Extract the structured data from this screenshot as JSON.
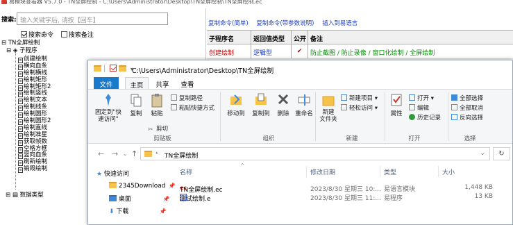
{
  "background_app": {
    "title": "易模块查看器 V5.7.0 - TN全屏绘制 - C:\\Users\\Administrator\\Desktop\\TN全屏绘制\\TN全屏绘制.ec",
    "search": {
      "label": "搜索:",
      "placeholder": "输入关键字后, 请按【回车】"
    },
    "filters": [
      {
        "label": "搜索命令",
        "checked": true
      },
      {
        "label": "搜索备注",
        "checked": false
      }
    ],
    "tree": {
      "root": "TN全屏绘制",
      "subprogram": "子程序",
      "items": [
        "创建绘制",
        "横向血条",
        "绘制横线",
        "绘制矩形",
        "绘制矩形2",
        "绘制竖线",
        "绘制文本",
        "绘制线条",
        "绘制圆形",
        "绘制圆形2",
        "绘制直线",
        "绘制准星",
        "获取帧数",
        "空格方框",
        "竖向血条",
        "刷新绘制",
        "销毁绘制"
      ],
      "datatype": "数据类型"
    },
    "links": [
      "复制命令(简单)",
      "复制命令(带参数说明)",
      "插入到易语言"
    ],
    "table": {
      "headers": [
        "子程序名",
        "返回值类型",
        "公开",
        "备注"
      ],
      "rows": [
        {
          "name": "创建绘制",
          "return_type": "逻辑型",
          "public": "✔",
          "note": "防止截图 / 防止录像 / 窗口化绘制 / 全屏绘制"
        }
      ]
    }
  },
  "explorer": {
    "title_path": "C:\\Users\\Administrator\\Desktop\\TN全屏绘制",
    "tabs": [
      "文件",
      "主页",
      "共享",
      "查看"
    ],
    "ribbon": {
      "pin_quick_access": "固定到\"快\n速访问\"",
      "copy": "复制",
      "paste": "粘贴",
      "copy_path": "复制路径",
      "paste_shortcut": "粘贴快捷方式",
      "cut": "剪切",
      "clipboard_group": "剪贴板",
      "move_to": "移动到",
      "copy_to": "复制到",
      "delete": "删除",
      "rename": "重命名",
      "organize_group": "组织",
      "new_folder": "新建\n文件夹",
      "new_item": "新建项目",
      "easy_access": "轻松访问",
      "new_group": "新建",
      "properties": "属性",
      "open": "打开",
      "edit": "编辑",
      "history": "历史记录",
      "open_group": "打开",
      "select_all": "全部选择",
      "select_none": "全部取消",
      "invert_selection": "反向选择",
      "select_group": "选择"
    },
    "address": {
      "crumb": "TN全屏绘制"
    },
    "nav": {
      "quick_access": "快速访问",
      "items": [
        "2345Download",
        "桌面",
        "下载"
      ]
    },
    "columns": [
      "名称",
      "修改日期",
      "类型",
      "大小"
    ],
    "files": [
      {
        "name": "TN全屏绘制.ec",
        "date": "2023/8/30 星期三 10:...",
        "type": "易语言模块",
        "size": "1,448 KB"
      },
      {
        "name": "测试绘制.e",
        "date": "2023/8/30 星期三 11:...",
        "type": "易程序",
        "size": "13 KB"
      }
    ]
  }
}
